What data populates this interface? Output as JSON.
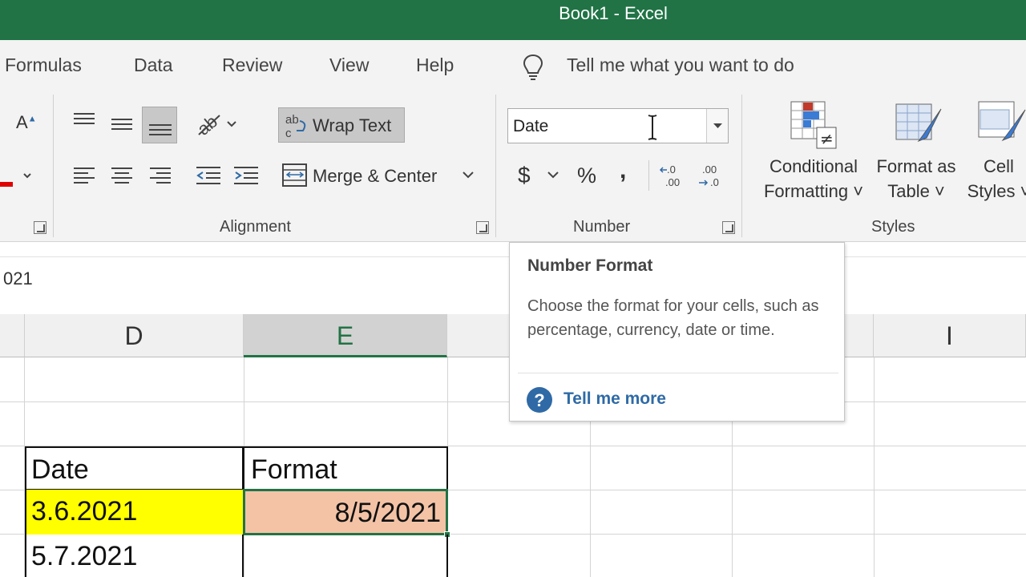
{
  "window": {
    "title": "Book1  -  Excel"
  },
  "menu": {
    "tabs": [
      "Formulas",
      "Data",
      "Review",
      "View",
      "Help"
    ],
    "tell_me": "Tell me what you want to do"
  },
  "ribbon": {
    "alignment": {
      "label": "Alignment",
      "wrap_text": "Wrap Text",
      "merge_center": "Merge & Center"
    },
    "number": {
      "label": "Number",
      "format_value": "Date",
      "currency_symbol": "$",
      "percent_symbol": "%",
      "comma_symbol": ","
    },
    "styles": {
      "label": "Styles",
      "conditional_formatting": [
        "Conditional",
        "Formatting ˅"
      ],
      "format_as_table": [
        "Format as",
        "Table ˅"
      ],
      "cell_styles": [
        "Cell",
        "Styles ˅"
      ]
    }
  },
  "formula_bar": {
    "value": "021"
  },
  "grid": {
    "columns": [
      "D",
      "E",
      "I"
    ],
    "selected_column": "E",
    "cells": {
      "header_date": "Date",
      "header_format": "Format",
      "d_row1": "3.6.2021",
      "e_row1": "8/5/2021",
      "d_row2": "5.7.2021"
    },
    "colors": {
      "highlight_yellow": "#ffff00",
      "highlight_peach": "#f4c3a6",
      "accent": "#217346"
    }
  },
  "tooltip": {
    "title": "Number Format",
    "body": "Choose the format for your cells, such as percentage, currency, date or time.",
    "link": "Tell me more"
  }
}
